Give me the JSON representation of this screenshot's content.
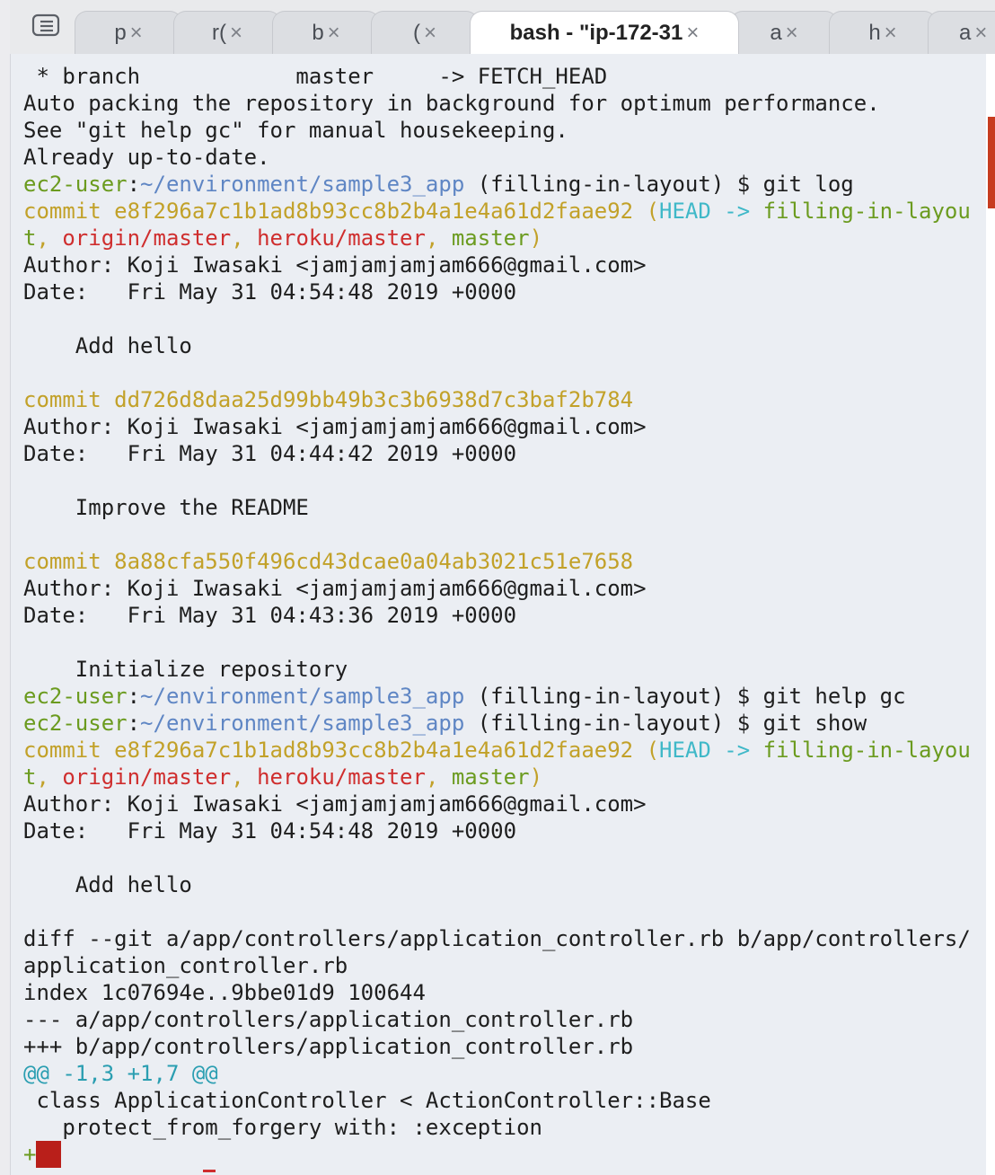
{
  "tabs": [
    {
      "label": "p",
      "close": "×"
    },
    {
      "label": "r(",
      "close": "×"
    },
    {
      "label": "b",
      "close": "×"
    },
    {
      "label": "(",
      "close": "×"
    },
    {
      "label": "bash - \"ip-172-31",
      "close": "×"
    },
    {
      "label": "a",
      "close": "×"
    },
    {
      "label": "h",
      "close": "×"
    },
    {
      "label": "a",
      "close": "×"
    }
  ],
  "icons": {
    "menu": "list-menu-icon",
    "scroll": "scroll-position-marker"
  },
  "colors": {
    "prompt_user": "#6b9b1f",
    "prompt_path": "#5f86c4",
    "commit": "#c2a129",
    "head": "#3fb8c8",
    "remote": "#cf2e2e",
    "diff_hunk": "#2a9eb1",
    "cursor": "#b91f1a",
    "terminal_bg": "#ebeef3"
  },
  "terminal": {
    "l01": {
      "t": " * branch            master     -> FETCH_HEAD"
    },
    "l02": {
      "t": "Auto packing the repository in background for optimum performance."
    },
    "l03": {
      "t": "See \"git help gc\" for manual housekeeping."
    },
    "l04": {
      "t": "Already up-to-date."
    },
    "l05": {
      "user": "ec2-user",
      "colon": ":",
      "path": "~/environment/sample3_app",
      "rest": " (filling-in-layout) $ git log"
    },
    "l06": {
      "commit": "commit e8f296a7c1b1ad8b93cc8b2b4a1e4a61d2faae92",
      "p1": " (",
      "head": "HEAD ->",
      "branch": " filling-in-layou"
    },
    "l07": {
      "a": "t",
      "s1": ", ",
      "origin": "origin/master",
      "s2": ", ",
      "heroku": "heroku/master",
      "s3": ", ",
      "master": "master",
      "close": ")"
    },
    "l08": {
      "t": "Author: Koji Iwasaki <jamjamjamjam666@gmail.com>"
    },
    "l09": {
      "t": "Date:   Fri May 31 04:54:48 2019 +0000"
    },
    "l11": {
      "t": "    Add hello"
    },
    "l13": {
      "commit": "commit dd726d8daa25d99bb49b3c3b6938d7c3baf2b784"
    },
    "l14": {
      "t": "Author: Koji Iwasaki <jamjamjamjam666@gmail.com>"
    },
    "l15": {
      "t": "Date:   Fri May 31 04:44:42 2019 +0000"
    },
    "l17": {
      "t": "    Improve the README"
    },
    "l19": {
      "commit": "commit 8a88cfa550f496cd43dcae0a04ab3021c51e7658"
    },
    "l20": {
      "t": "Author: Koji Iwasaki <jamjamjamjam666@gmail.com>"
    },
    "l21": {
      "t": "Date:   Fri May 31 04:43:36 2019 +0000"
    },
    "l23": {
      "t": "    Initialize repository"
    },
    "l24": {
      "user": "ec2-user",
      "colon": ":",
      "path": "~/environment/sample3_app",
      "rest": " (filling-in-layout) $ git help gc"
    },
    "l25": {
      "user": "ec2-user",
      "colon": ":",
      "path": "~/environment/sample3_app",
      "rest": " (filling-in-layout) $ git show"
    },
    "l26": {
      "commit": "commit e8f296a7c1b1ad8b93cc8b2b4a1e4a61d2faae92",
      "p1": " (",
      "head": "HEAD ->",
      "branch": " filling-in-layou"
    },
    "l27": {
      "a": "t",
      "s1": ", ",
      "origin": "origin/master",
      "s2": ", ",
      "heroku": "heroku/master",
      "s3": ", ",
      "master": "master",
      "close": ")"
    },
    "l28": {
      "t": "Author: Koji Iwasaki <jamjamjamjam666@gmail.com>"
    },
    "l29": {
      "t": "Date:   Fri May 31 04:54:48 2019 +0000"
    },
    "l31": {
      "t": "    Add hello"
    },
    "l33": {
      "t": "diff --git a/app/controllers/application_controller.rb b/app/controllers/"
    },
    "l34": {
      "t": "application_controller.rb"
    },
    "l35": {
      "t": "index 1c07694e..9bbe01d9 100644"
    },
    "l36": {
      "t": "--- a/app/controllers/application_controller.rb"
    },
    "l37": {
      "t": "+++ b/app/controllers/application_controller.rb"
    },
    "l38": {
      "t": "@@ -1,3 +1,7 @@"
    },
    "l39": {
      "t": " class ApplicationController < ActionController::Base"
    },
    "l40": {
      "t": "   protect_from_forgery with: :exception"
    },
    "l41": {
      "plus": "+"
    }
  }
}
